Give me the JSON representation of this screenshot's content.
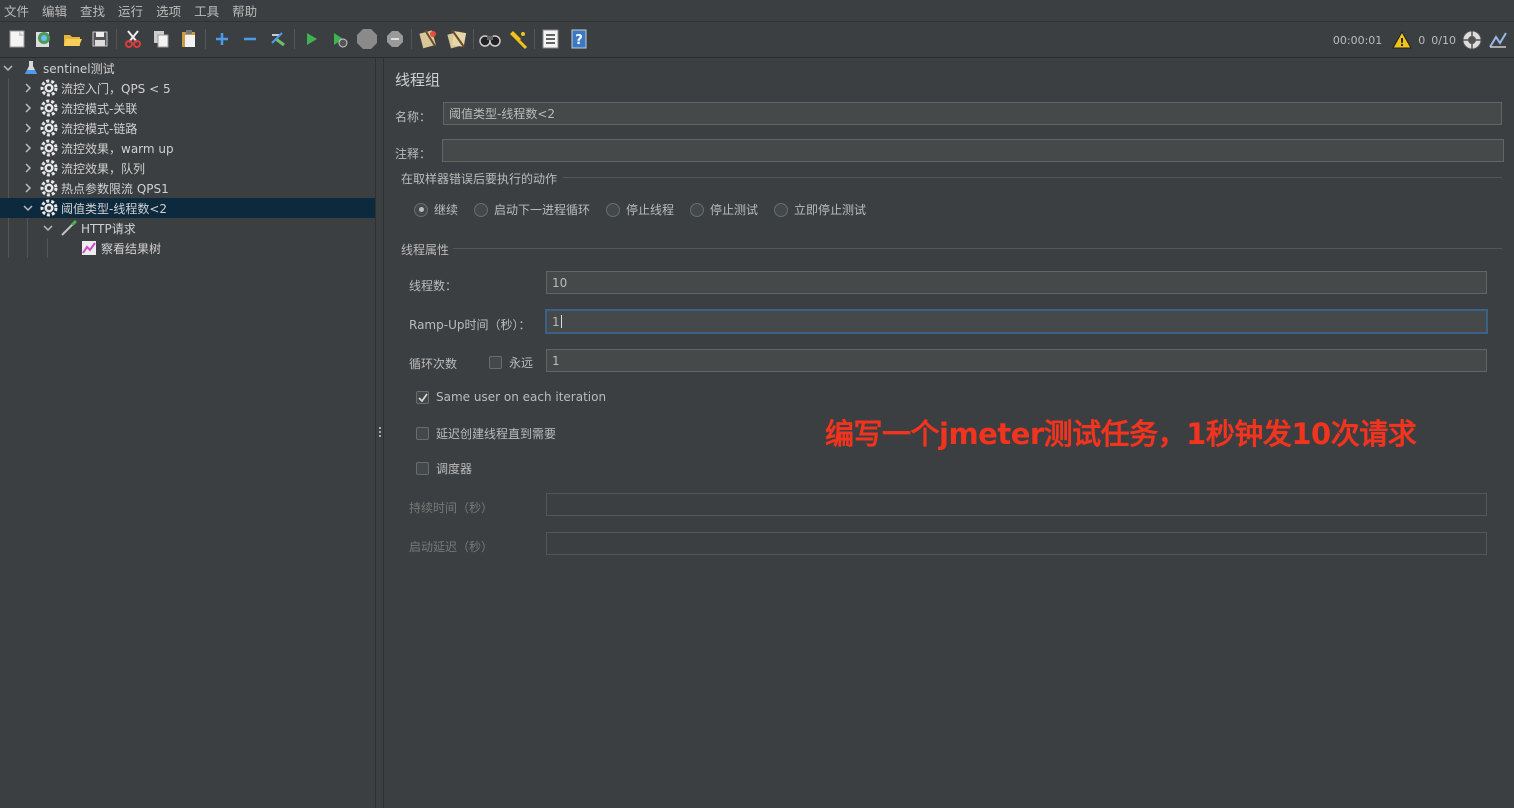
{
  "menu": [
    "文件",
    "编辑",
    "查找",
    "运行",
    "选项",
    "工具",
    "帮助"
  ],
  "toolbar": {
    "icons": [
      "new-icon",
      "templates-icon",
      "open-icon",
      "save-icon",
      "cut-icon",
      "copy-icon",
      "paste-icon",
      "expand-icon",
      "collapse-icon",
      "toggle-icon",
      "start-icon",
      "start-no-pause-icon",
      "stop-icon",
      "shutdown-icon",
      "clear-icon",
      "clear-all-icon",
      "search-icon",
      "reset-search-icon",
      "function-helper-icon",
      "help-icon"
    ],
    "timer": "00:00:01",
    "warnings": "0",
    "threads": "0/10",
    "accent": "#f0c419"
  },
  "tree": {
    "root": "sentinel测试",
    "items": [
      "流控入门，QPS < 5",
      "流控模式-关联",
      "流控模式-链路",
      "流控效果，warm up",
      "流控效果，队列",
      "热点参数限流 QPS1",
      "阈值类型-线程数<2"
    ],
    "child": "HTTP请求",
    "grandchild": "察看结果树"
  },
  "form": {
    "title": "线程组",
    "name_label": "名称：",
    "name_value": "阈值类型-线程数<2",
    "comment_label": "注释：",
    "comment_value": "",
    "error_group_title": "在取样器错误后要执行的动作",
    "actions": [
      "继续",
      "启动下一进程循环",
      "停止线程",
      "停止测试",
      "立即停止测试"
    ],
    "selected_action": "继续",
    "thread_group_title": "线程属性",
    "threads_label": "线程数：",
    "threads_value": "10",
    "rampup_label": "Ramp-Up时间（秒）：",
    "rampup_value": "1",
    "loop_label": "循环次数",
    "forever_label": "永远",
    "loop_value": "1",
    "same_user_label": "Same user on each iteration",
    "same_user_checked": true,
    "delay_create_label": "延迟创建线程直到需要",
    "scheduler_label": "调度器",
    "duration_label": "持续时间（秒）",
    "duration_value": "",
    "startup_delay_label": "启动延迟（秒）",
    "startup_delay_value": ""
  },
  "annotation": {
    "text": "编写一个jmeter测试任务，1秒钟发10次请求",
    "color": "#f2331e"
  }
}
